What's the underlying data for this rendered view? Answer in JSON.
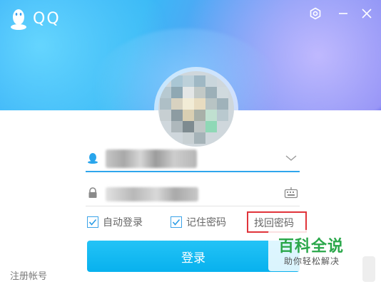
{
  "app": {
    "title": "QQ"
  },
  "window_controls": {
    "settings": "gear-icon",
    "minimize": "minimize-icon",
    "close": "close-icon"
  },
  "form": {
    "account_value": "",
    "password_value": ""
  },
  "options": {
    "auto_login_label": "自动登录",
    "auto_login_checked": true,
    "remember_password_label": "记住密码",
    "remember_password_checked": true,
    "find_password_label": "找回密码"
  },
  "login_button_label": "登录",
  "register_label": "注册帐号",
  "watermark": {
    "title": "百科全说",
    "subtitle": "助你轻松解决"
  },
  "colors": {
    "accent": "#2fa6ec",
    "login_button": "#0db4ef",
    "highlight_box": "#e0343a",
    "watermark_green": "#2aa74a"
  }
}
